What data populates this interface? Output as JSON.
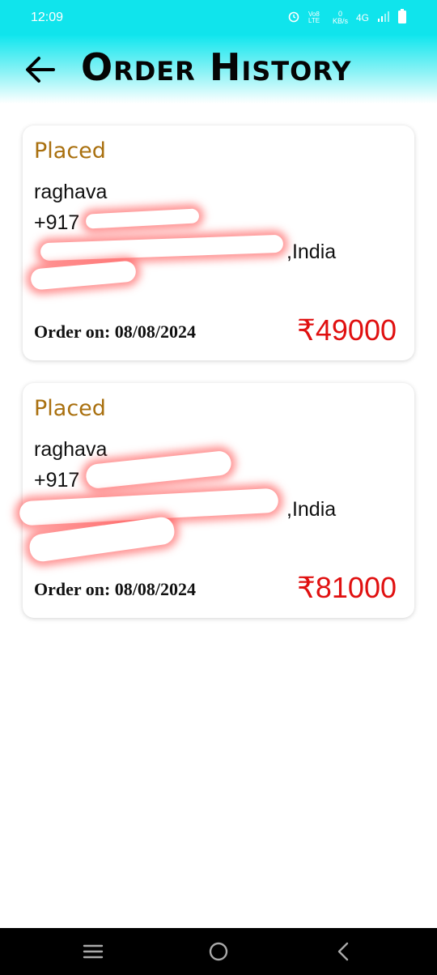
{
  "status_bar": {
    "time": "12:09",
    "network_label": "4G",
    "speed_value": "0",
    "speed_unit": "KB/s",
    "volte_label": "Vo8 LTE"
  },
  "header": {
    "title": "Order History",
    "back_icon": "arrow-left-icon"
  },
  "orders": [
    {
      "status": "Placed",
      "name": "raghava",
      "phone_visible": "+917",
      "address_visible": ",India",
      "order_on": "Order on: 08/08/2024",
      "price": "₹49000"
    },
    {
      "status": "Placed",
      "name": "raghava",
      "phone_visible": "+917",
      "address_visible": ",India",
      "order_on": "Order on: 08/08/2024",
      "price": "₹81000"
    }
  ],
  "nav": {
    "menu_icon": "menu-icon",
    "home_icon": "home-circle-icon",
    "back_icon": "back-chevron-icon"
  },
  "colors": {
    "header_accent": "#12e6ee",
    "status_text": "#a9700f",
    "price_text": "#e01010"
  }
}
